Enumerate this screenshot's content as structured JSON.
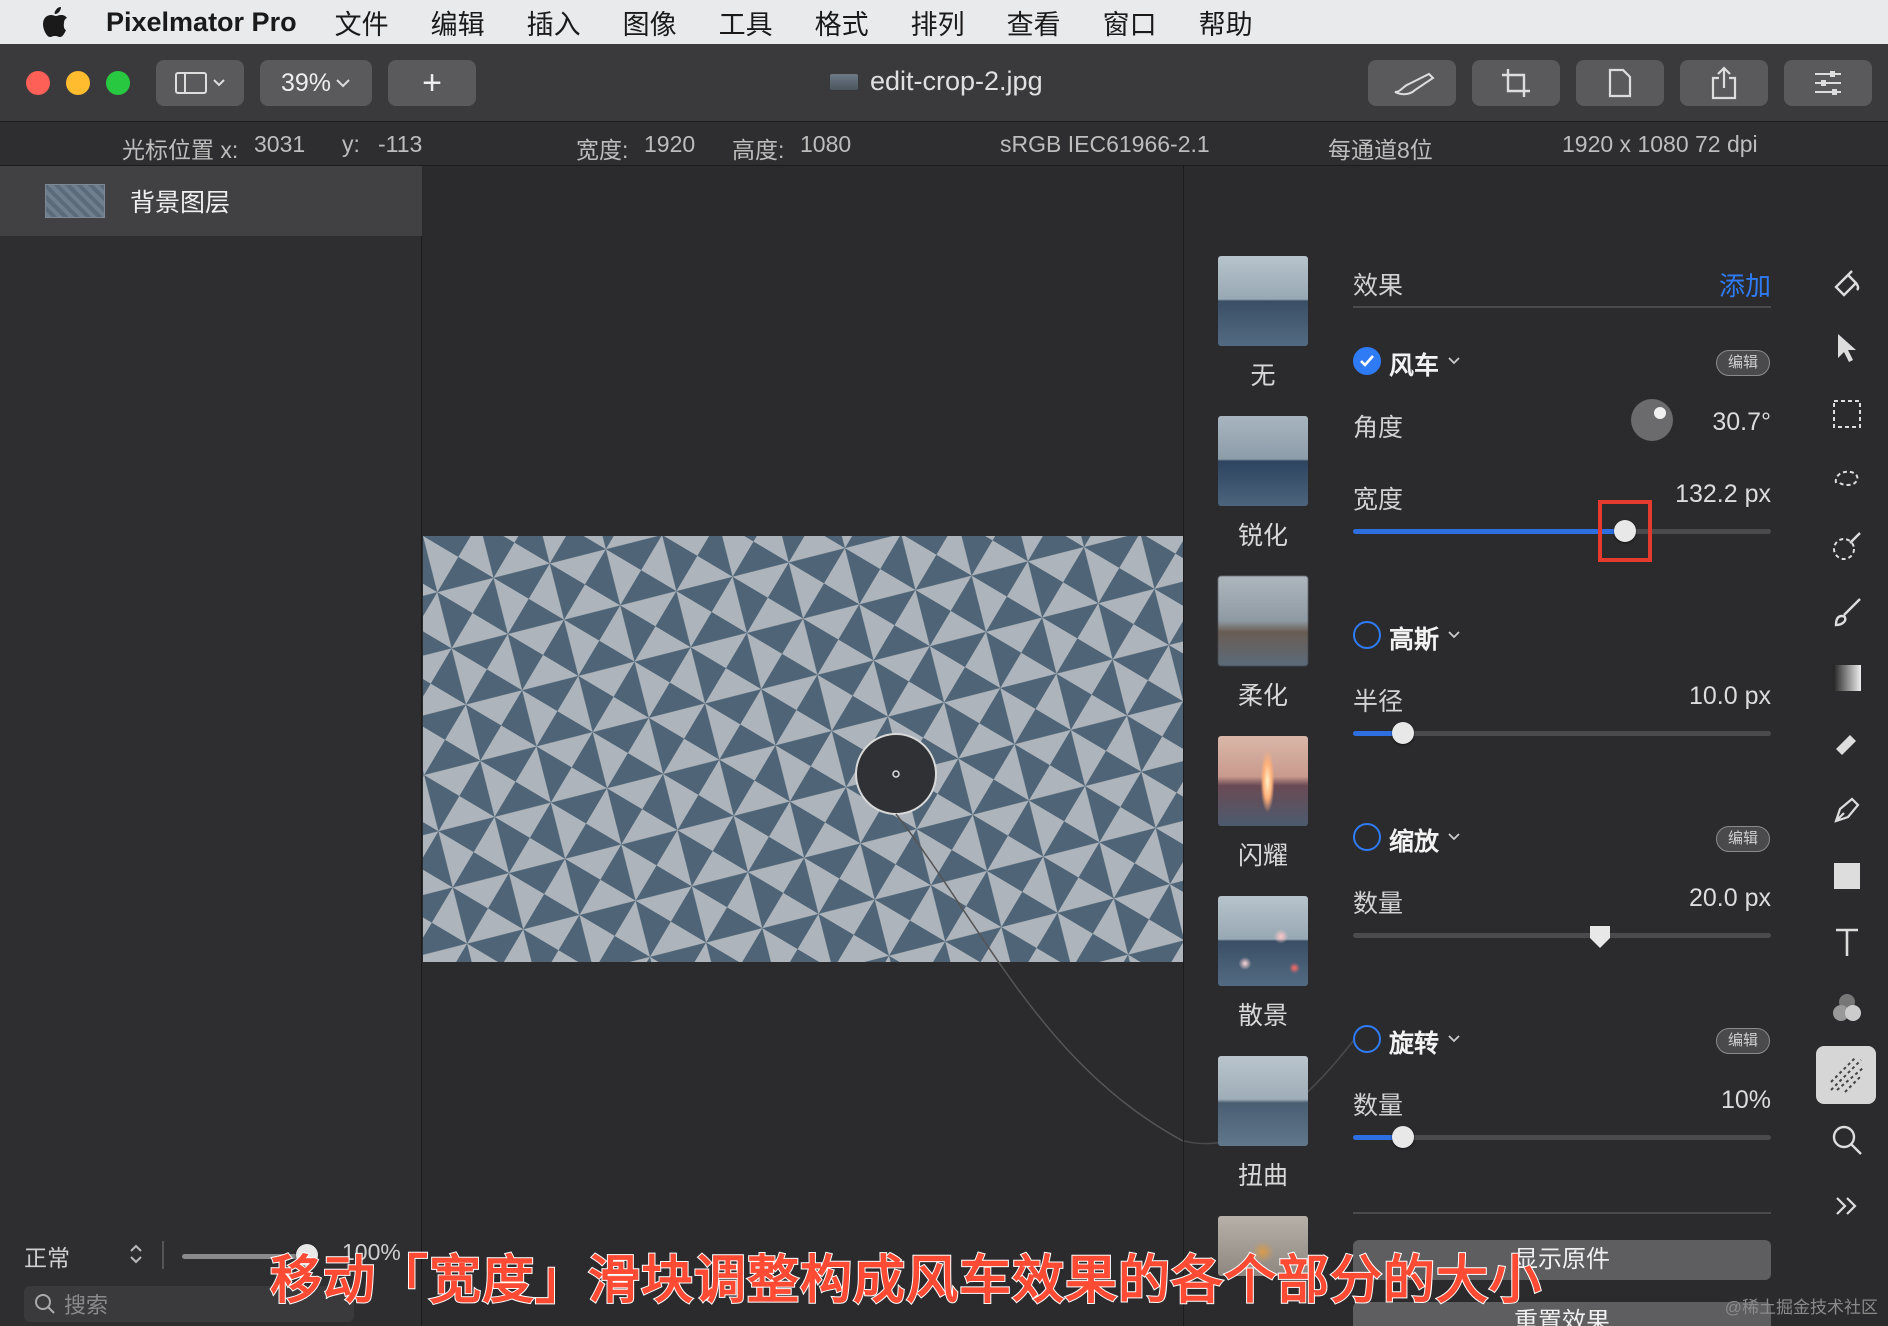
{
  "menubar": {
    "app_name": "Pixelmator Pro",
    "items": [
      "文件",
      "编辑",
      "插入",
      "图像",
      "工具",
      "格式",
      "排列",
      "查看",
      "窗口",
      "帮助"
    ]
  },
  "toolbar": {
    "zoom": "39%",
    "add": "+",
    "filename": "edit-crop-2.jpg"
  },
  "infobar": {
    "cursor_x_label": "光标位置 x:",
    "cursor_x": "3031",
    "cursor_y_label": "y:",
    "cursor_y": "-113",
    "width_label": "宽度:",
    "width": "1920",
    "height_label": "高度:",
    "height": "1080",
    "color_profile": "sRGB IEC61966-2.1",
    "bit_depth": "每通道8位",
    "resolution": "1920 x 1080 72 dpi"
  },
  "layers": {
    "layer_name": "背景图层",
    "blend_mode": "正常",
    "opacity": "100%",
    "opacity_fraction": 1.0,
    "search_placeholder": "搜索"
  },
  "thumbnails": [
    {
      "label": "无"
    },
    {
      "label": "锐化"
    },
    {
      "label": "柔化"
    },
    {
      "label": "闪耀"
    },
    {
      "label": "散景"
    },
    {
      "label": "扭曲"
    }
  ],
  "effects": {
    "header": "效果",
    "add": "添加",
    "pinwheel": {
      "name": "风车",
      "edit": "编辑",
      "angle_label": "角度",
      "angle_value": "30.7°",
      "width_label": "宽度",
      "width_value": "132.2 px",
      "width_fraction": 0.65
    },
    "gaussian": {
      "name": "高斯",
      "radius_label": "半径",
      "radius_value": "10.0 px",
      "radius_fraction": 0.12
    },
    "zoom": {
      "name": "缩放",
      "edit": "编辑",
      "amount_label": "数量",
      "amount_value": "20.0 px",
      "amount_fraction": 0.59
    },
    "spin": {
      "name": "旋转",
      "edit": "编辑",
      "amount_label": "数量",
      "amount_value": "10%",
      "amount_fraction": 0.12
    },
    "show_original": "显示原件",
    "reset": "重置效果"
  },
  "caption": "移动「宽度」滑块调整构成风车效果的各个部分的大小",
  "watermark": "@稀土掘金技术社区",
  "colors": {
    "accent": "#2f7bf5",
    "highlight": "#e53b2f"
  }
}
